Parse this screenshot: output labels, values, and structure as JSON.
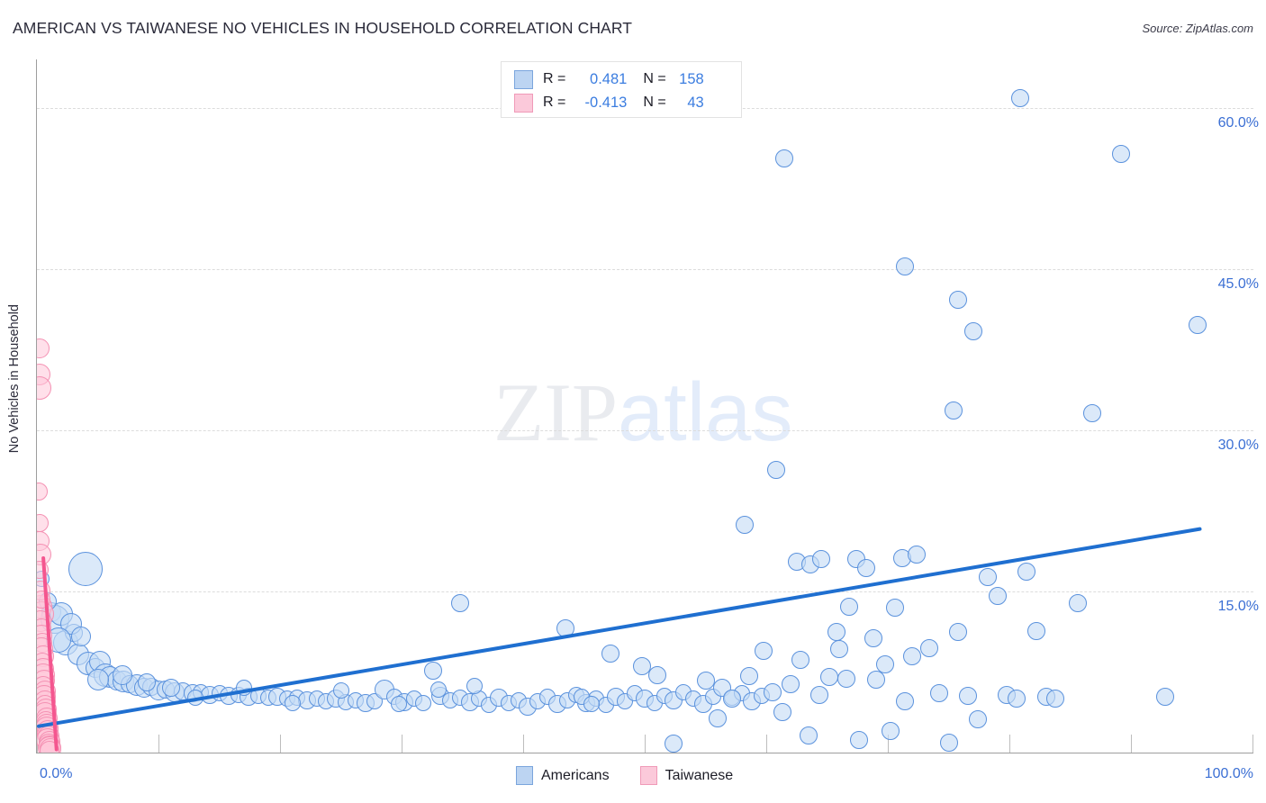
{
  "header": {
    "title": "AMERICAN VS TAIWANESE NO VEHICLES IN HOUSEHOLD CORRELATION CHART",
    "source": "Source: ZipAtlas.com"
  },
  "watermark": {
    "part1": "ZIP",
    "part2": "atlas"
  },
  "stats": {
    "rows": [
      {
        "series": "Americans",
        "r_label": "R =",
        "r_value": "0.481",
        "n_label": "N =",
        "n_value": "158",
        "color": "#bcd4f2"
      },
      {
        "series": "Taiwanese",
        "r_label": "R =",
        "r_value": "-0.413",
        "n_label": "N =",
        "n_value": "43",
        "color": "#fbc9da"
      }
    ]
  },
  "legend": {
    "items": [
      {
        "label": "Americans",
        "color": "#bcd4f2",
        "border": "#7aa5dd"
      },
      {
        "label": "Taiwanese",
        "color": "#fbc9da",
        "border": "#f09ab8"
      }
    ]
  },
  "chart_data": {
    "type": "scatter",
    "title": "AMERICAN VS TAIWANESE NO VEHICLES IN HOUSEHOLD CORRELATION CHART",
    "xlabel": "",
    "ylabel": "No Vehicles in Household",
    "xlim": [
      0,
      100
    ],
    "ylim": [
      0,
      64.5
    ],
    "x_ticks": [
      "0.0%",
      "100.0%"
    ],
    "y_ticks": [
      "60.0%",
      "45.0%",
      "30.0%",
      "15.0%"
    ],
    "y_tick_values": [
      60,
      45,
      30,
      15
    ],
    "grid": "horizontal-dashed",
    "legend_position": "bottom-center",
    "series": [
      {
        "name": "Americans",
        "color": "#c5dcf6",
        "border": "#5b92dd",
        "r": 0.481,
        "n": 158,
        "trendline": {
          "x0": 0,
          "y0": 2.4,
          "x1": 95.8,
          "y1": 20.8
        },
        "points": [
          [
            0.4,
            16.2,
            9
          ],
          [
            1.2,
            13.1,
            11
          ],
          [
            1.5,
            12.4,
            16
          ],
          [
            2.0,
            12.9,
            13
          ],
          [
            2.4,
            10.2,
            14
          ],
          [
            3.0,
            11.1,
            10
          ],
          [
            3.4,
            9.1,
            12
          ],
          [
            4.0,
            17.1,
            19
          ],
          [
            4.2,
            8.3,
            13
          ],
          [
            4.8,
            7.9,
            11
          ],
          [
            5.2,
            8.5,
            12
          ],
          [
            5.6,
            7.2,
            13
          ],
          [
            6.0,
            7.0,
            12
          ],
          [
            6.6,
            6.7,
            11
          ],
          [
            7.1,
            6.6,
            12
          ],
          [
            7.6,
            6.4,
            10
          ],
          [
            8.2,
            6.3,
            12
          ],
          [
            8.8,
            6.0,
            11
          ],
          [
            9.4,
            6.1,
            10
          ],
          [
            10.0,
            5.8,
            11
          ],
          [
            10.6,
            5.9,
            10
          ],
          [
            11.3,
            5.6,
            11
          ],
          [
            12.0,
            5.7,
            10
          ],
          [
            12.8,
            5.5,
            10
          ],
          [
            13.5,
            5.6,
            9
          ],
          [
            14.2,
            5.4,
            10
          ],
          [
            15.0,
            5.5,
            9
          ],
          [
            15.8,
            5.3,
            10
          ],
          [
            16.6,
            5.4,
            9
          ],
          [
            17.4,
            5.2,
            10
          ],
          [
            18.2,
            5.3,
            9
          ],
          [
            19.0,
            5.1,
            9
          ],
          [
            19.8,
            5.2,
            10
          ],
          [
            20.6,
            5.0,
            9
          ],
          [
            21.4,
            5.1,
            9
          ],
          [
            22.2,
            4.9,
            10
          ],
          [
            23.0,
            5.0,
            9
          ],
          [
            23.8,
            4.8,
            9
          ],
          [
            24.6,
            5.0,
            10
          ],
          [
            25.4,
            4.7,
            9
          ],
          [
            26.2,
            4.9,
            9
          ],
          [
            27.0,
            4.6,
            10
          ],
          [
            27.8,
            4.8,
            9
          ],
          [
            28.6,
            5.9,
            11
          ],
          [
            29.4,
            5.2,
            9
          ],
          [
            30.2,
            4.7,
            10
          ],
          [
            31.0,
            5.0,
            9
          ],
          [
            31.8,
            4.6,
            9
          ],
          [
            32.6,
            7.6,
            10
          ],
          [
            33.2,
            5.3,
            10
          ],
          [
            34.0,
            4.9,
            9
          ],
          [
            34.8,
            5.1,
            9
          ],
          [
            35.6,
            4.7,
            10
          ],
          [
            36.4,
            5.0,
            9
          ],
          [
            37.2,
            4.4,
            9
          ],
          [
            38.0,
            5.1,
            10
          ],
          [
            38.8,
            4.6,
            9
          ],
          [
            39.6,
            4.9,
            9
          ],
          [
            40.4,
            4.3,
            10
          ],
          [
            41.2,
            4.8,
            9
          ],
          [
            42.0,
            5.2,
            9
          ],
          [
            42.8,
            4.5,
            10
          ],
          [
            43.6,
            4.9,
            9
          ],
          [
            44.4,
            5.4,
            9
          ],
          [
            45.2,
            4.6,
            10
          ],
          [
            46.0,
            5.0,
            9
          ],
          [
            46.8,
            4.4,
            9
          ],
          [
            47.6,
            5.2,
            10
          ],
          [
            48.4,
            4.8,
            9
          ],
          [
            49.2,
            5.5,
            9
          ],
          [
            50.0,
            5.0,
            10
          ],
          [
            50.8,
            4.6,
            9
          ],
          [
            51.6,
            5.3,
            9
          ],
          [
            52.4,
            4.9,
            10
          ],
          [
            53.2,
            5.6,
            9
          ],
          [
            54.0,
            5.0,
            9
          ],
          [
            54.8,
            4.5,
            10
          ],
          [
            55.6,
            5.2,
            9
          ],
          [
            56.4,
            6.0,
            10
          ],
          [
            57.2,
            5.1,
            9
          ],
          [
            58.0,
            5.5,
            9
          ],
          [
            58.8,
            4.8,
            10
          ],
          [
            59.6,
            5.3,
            9
          ],
          [
            34.8,
            13.9,
            10
          ],
          [
            43.5,
            11.6,
            10
          ],
          [
            47.2,
            9.2,
            10
          ],
          [
            49.8,
            8.0,
            10
          ],
          [
            51.0,
            7.2,
            10
          ],
          [
            52.4,
            0.8,
            10
          ],
          [
            55.0,
            6.7,
            10
          ],
          [
            56.0,
            3.2,
            10
          ],
          [
            57.2,
            5.0,
            10
          ],
          [
            58.6,
            7.1,
            10
          ],
          [
            59.8,
            9.5,
            10
          ],
          [
            60.5,
            5.6,
            10
          ],
          [
            61.3,
            3.8,
            10
          ],
          [
            62.0,
            6.4,
            10
          ],
          [
            62.8,
            8.6,
            10
          ],
          [
            63.5,
            1.6,
            10
          ],
          [
            64.4,
            5.4,
            10
          ],
          [
            65.2,
            7.0,
            10
          ],
          [
            66.0,
            9.6,
            10
          ],
          [
            66.8,
            13.6,
            10
          ],
          [
            67.4,
            18.0,
            10
          ],
          [
            68.2,
            17.2,
            10
          ],
          [
            69.0,
            6.8,
            10
          ],
          [
            69.8,
            8.2,
            10
          ],
          [
            70.6,
            13.5,
            10
          ],
          [
            71.4,
            4.8,
            10
          ],
          [
            72.0,
            9.0,
            10
          ],
          [
            58.2,
            21.2,
            10
          ],
          [
            60.8,
            26.3,
            10
          ],
          [
            62.5,
            17.8,
            10
          ],
          [
            63.6,
            17.5,
            10
          ],
          [
            64.5,
            18.0,
            10
          ],
          [
            65.8,
            11.2,
            10
          ],
          [
            66.6,
            6.9,
            10
          ],
          [
            67.6,
            1.2,
            10
          ],
          [
            68.8,
            10.6,
            10
          ],
          [
            70.2,
            2.0,
            10
          ],
          [
            71.2,
            18.1,
            10
          ],
          [
            72.4,
            18.4,
            10
          ],
          [
            73.4,
            9.7,
            10
          ],
          [
            74.2,
            5.5,
            10
          ],
          [
            75.0,
            0.9,
            10
          ],
          [
            75.8,
            11.2,
            10
          ],
          [
            76.6,
            5.3,
            10
          ],
          [
            77.4,
            3.1,
            10
          ],
          [
            78.2,
            16.3,
            10
          ],
          [
            79.0,
            14.6,
            10
          ],
          [
            79.8,
            5.4,
            10
          ],
          [
            80.6,
            5.0,
            10
          ],
          [
            81.4,
            16.8,
            10
          ],
          [
            82.2,
            11.3,
            10
          ],
          [
            83.0,
            5.2,
            10
          ],
          [
            83.8,
            5.0,
            10
          ],
          [
            61.5,
            55.3,
            10
          ],
          [
            71.4,
            45.2,
            10
          ],
          [
            75.8,
            42.1,
            10
          ],
          [
            77.0,
            39.2,
            10
          ],
          [
            75.4,
            31.8,
            10
          ],
          [
            80.9,
            60.9,
            10
          ],
          [
            86.8,
            31.6,
            10
          ],
          [
            89.2,
            55.7,
            10
          ],
          [
            95.5,
            39.8,
            10
          ],
          [
            85.6,
            13.9,
            10
          ],
          [
            92.8,
            5.2,
            10
          ],
          [
            44.8,
            5.2,
            9
          ],
          [
            45.6,
            4.5,
            9
          ],
          [
            36.0,
            6.2,
            9
          ],
          [
            29.8,
            4.5,
            9
          ],
          [
            21.0,
            4.6,
            9
          ],
          [
            13.0,
            5.1,
            9
          ],
          [
            2.8,
            12.0,
            12
          ],
          [
            1.8,
            10.5,
            14
          ],
          [
            3.6,
            10.8,
            11
          ],
          [
            0.9,
            14.1,
            10
          ],
          [
            5.0,
            6.8,
            12
          ],
          [
            7.0,
            7.2,
            11
          ],
          [
            9.0,
            6.5,
            10
          ],
          [
            11.0,
            6.0,
            10
          ],
          [
            17.0,
            6.0,
            9
          ],
          [
            25.0,
            5.8,
            9
          ],
          [
            33.0,
            5.9,
            9
          ]
        ]
      },
      {
        "name": "Taiwanese",
        "color": "#ffc7d8",
        "border": "#f491b3",
        "r": -0.413,
        "n": 43,
        "trendline": {
          "x0": 0.55,
          "y0": 18.3,
          "x1": 1.65,
          "y1": 0.2
        },
        "points": [
          [
            0.2,
            37.6,
            11
          ],
          [
            0.25,
            35.2,
            12
          ],
          [
            0.2,
            33.9,
            13
          ],
          [
            0.15,
            24.3,
            10
          ],
          [
            0.2,
            19.7,
            11
          ],
          [
            0.3,
            18.4,
            12
          ],
          [
            0.25,
            17.0,
            10
          ],
          [
            0.3,
            13.6,
            13
          ],
          [
            0.35,
            12.9,
            14
          ],
          [
            0.3,
            12.2,
            12
          ],
          [
            0.4,
            11.6,
            11
          ],
          [
            0.35,
            10.9,
            12
          ],
          [
            0.45,
            10.2,
            11
          ],
          [
            0.4,
            9.6,
            13
          ],
          [
            0.5,
            9.0,
            12
          ],
          [
            0.45,
            8.4,
            11
          ],
          [
            0.55,
            7.8,
            12
          ],
          [
            0.5,
            7.2,
            13
          ],
          [
            0.6,
            6.7,
            12
          ],
          [
            0.55,
            6.2,
            11
          ],
          [
            0.65,
            5.7,
            12
          ],
          [
            0.6,
            5.2,
            13
          ],
          [
            0.7,
            4.8,
            12
          ],
          [
            0.65,
            4.4,
            11
          ],
          [
            0.75,
            4.0,
            12
          ],
          [
            0.7,
            3.6,
            13
          ],
          [
            0.8,
            3.2,
            12
          ],
          [
            0.75,
            2.9,
            11
          ],
          [
            0.85,
            2.6,
            12
          ],
          [
            0.8,
            2.3,
            13
          ],
          [
            0.9,
            2.0,
            12
          ],
          [
            0.85,
            1.7,
            11
          ],
          [
            0.95,
            1.5,
            12
          ],
          [
            0.9,
            1.2,
            13
          ],
          [
            1.0,
            1.0,
            12
          ],
          [
            0.95,
            0.8,
            11
          ],
          [
            1.05,
            0.6,
            12
          ],
          [
            1.0,
            0.45,
            13
          ],
          [
            1.1,
            0.3,
            12
          ],
          [
            1.05,
            0.2,
            11
          ],
          [
            0.3,
            15.1,
            11
          ],
          [
            0.35,
            14.2,
            10
          ],
          [
            0.25,
            21.4,
            10
          ]
        ]
      }
    ]
  }
}
